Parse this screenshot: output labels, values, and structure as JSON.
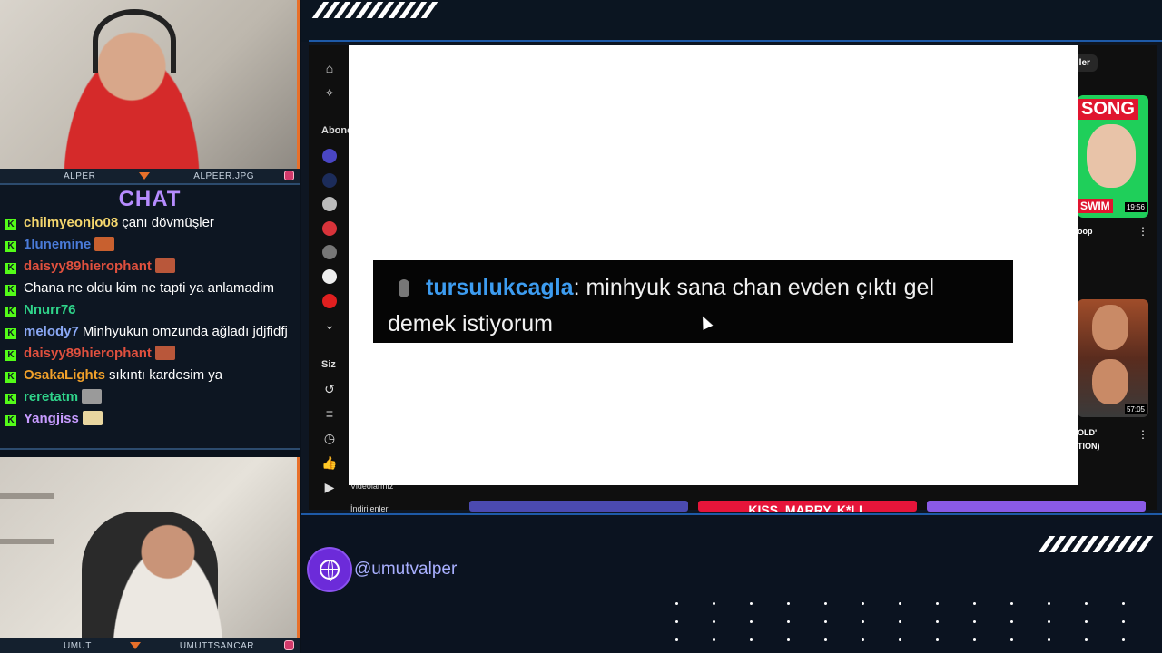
{
  "webcams": {
    "top": {
      "left_label": "ALPER",
      "right_label": "ALPEER.JPG"
    },
    "bottom": {
      "left_label": "UMUT",
      "right_label": "UMUTTSANCAR"
    }
  },
  "chat": {
    "title": "CHAT",
    "messages": [
      {
        "user": "chilmyeonjo08",
        "color": "#f5d76e",
        "text": "çanı dövmüşler",
        "emote": ""
      },
      {
        "user": "1lunemine",
        "color": "#4a7bd9",
        "text": "",
        "emote": "emote"
      },
      {
        "user": "daisyy89hierophant",
        "color": "#e0503e",
        "text": "",
        "emote": "emote"
      },
      {
        "user": "Chana",
        "color": "#ffffff",
        "text": "Chana ne oldu kim ne tapti ya anlamadim",
        "emote": ""
      },
      {
        "user": "Nnurr76",
        "color": "#2fd38a",
        "text": "",
        "emote": ""
      },
      {
        "user": "melody7",
        "color": "#8aa8f5",
        "text": "Minhyukun omzunda ağladı jdjfidfj",
        "emote": ""
      },
      {
        "user": "daisyy89hierophant",
        "color": "#e0503e",
        "text": "",
        "emote": "emote"
      },
      {
        "user": "OsakaLights",
        "color": "#f0a02a",
        "text": "sıkıntı kardesim ya",
        "emote": ""
      },
      {
        "user": "reretatm",
        "color": "#2fd38a",
        "text": "",
        "emote": "emote"
      },
      {
        "user": "Yangjiss",
        "color": "#c79bff",
        "text": "",
        "emote": "emote"
      }
    ]
  },
  "youtube": {
    "sidebar": {
      "subs_label": "Abone",
      "you_label": "Siz",
      "videos_label": "Videolarınız",
      "downloads_label": "İndirilenler"
    },
    "pill_label": "riler",
    "thumb_song": "SONG",
    "thumb_swim": "SWIM",
    "thumb_duration_1": "19:56",
    "thumb_title_1": "oop",
    "thumb_duration_2": "57:05",
    "thumb_title_2": "OLD'",
    "thumb_title_2b": "TION)",
    "bottom_thumb_text": "KISS, MARRY, K*LL"
  },
  "overlay_message": {
    "user": "tursulukcagla",
    "text": ": minhyuk sana chan evden çıktı gel demek istiyorum"
  },
  "footer": {
    "handle": "@umutvalper"
  }
}
